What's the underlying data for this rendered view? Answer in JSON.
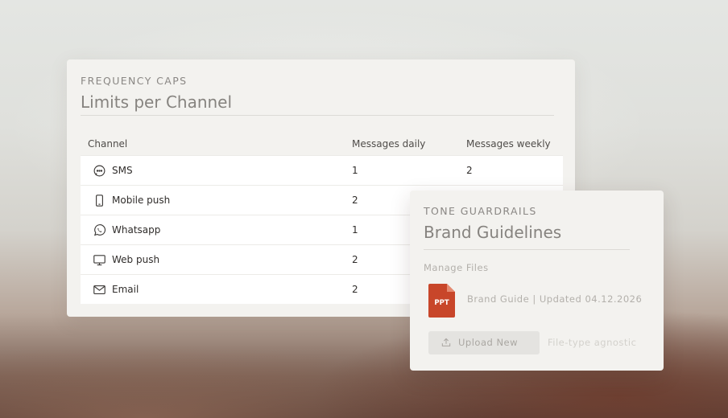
{
  "frequency_caps": {
    "eyebrow": "FREQUENCY CAPS",
    "title": "Limits per Channel",
    "columns": [
      "Channel",
      "Messages daily",
      "Messages weekly"
    ],
    "rows": [
      {
        "icon": "chat-bubble-icon",
        "channel": "SMS",
        "daily": "1",
        "weekly": "2"
      },
      {
        "icon": "mobile-phone-icon",
        "channel": "Mobile push",
        "daily": "2",
        "weekly": ""
      },
      {
        "icon": "whatsapp-icon",
        "channel": "Whatsapp",
        "daily": "1",
        "weekly": ""
      },
      {
        "icon": "monitor-icon",
        "channel": "Web push",
        "daily": "2",
        "weekly": ""
      },
      {
        "icon": "envelope-icon",
        "channel": "Email",
        "daily": "2",
        "weekly": ""
      }
    ]
  },
  "tone_guardrails": {
    "eyebrow": "TONE GUARDRAILS",
    "title": "Brand Guidelines",
    "section_label": "Manage Files",
    "file": {
      "type_label": "PPT",
      "name": "Brand Guide | Updated 04.12.2026",
      "icon": "ppt-file-icon"
    },
    "upload_label": "Upload New",
    "hint": "File-type agnostic"
  },
  "colors": {
    "ppt_red": "#c8462a",
    "card_bg": "#f3f2ef"
  }
}
